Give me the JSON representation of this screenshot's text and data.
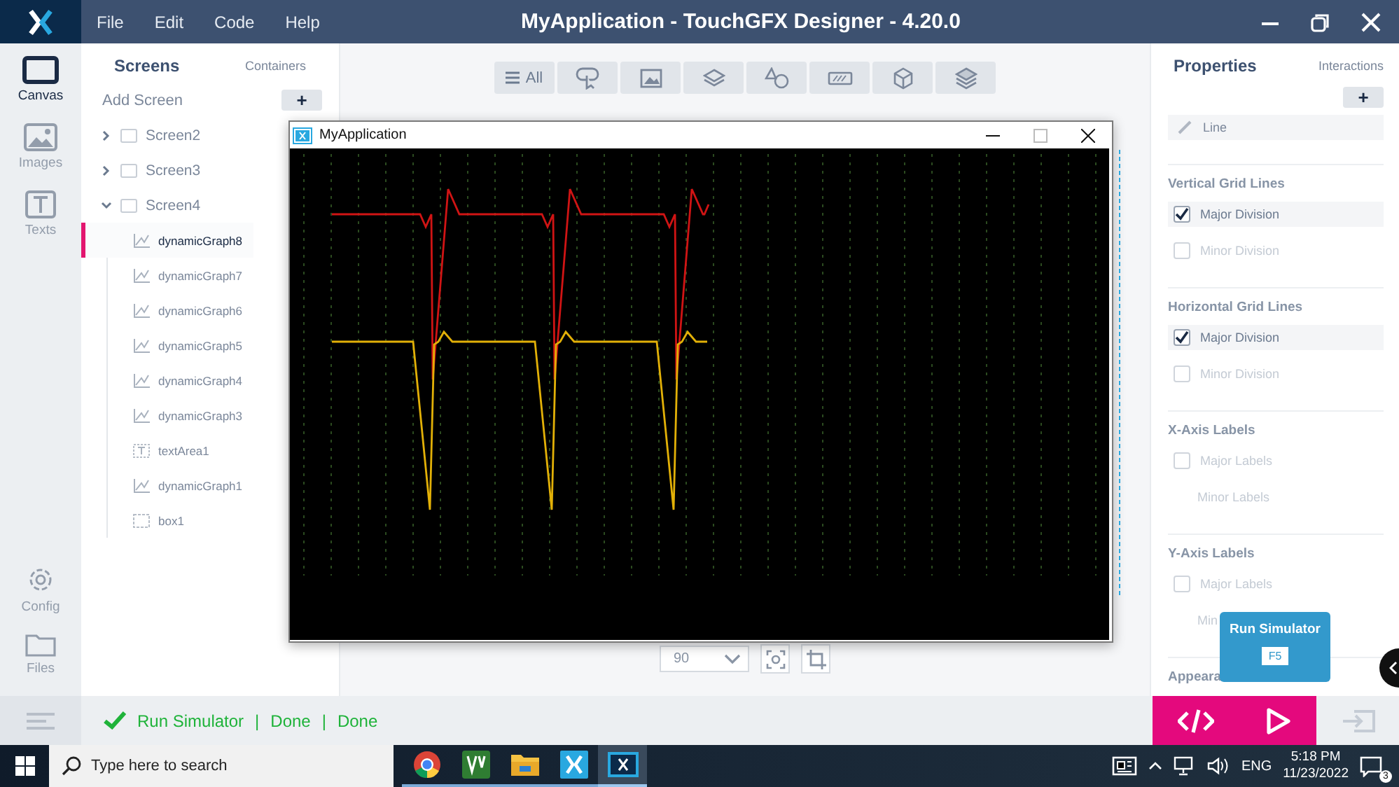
{
  "titlebar": {
    "menu": [
      "File",
      "Edit",
      "Code",
      "Help"
    ],
    "title": "MyApplication - TouchGFX Designer - 4.20.0"
  },
  "rail": {
    "items": [
      {
        "label": "Canvas",
        "kind": "canvas",
        "selected": true
      },
      {
        "label": "Images",
        "kind": "images",
        "selected": false
      },
      {
        "label": "Texts",
        "kind": "texts",
        "selected": false
      }
    ],
    "bottom_items": [
      {
        "label": "Config",
        "kind": "gear",
        "selected": false
      },
      {
        "label": "Files",
        "kind": "folder",
        "selected": false
      }
    ]
  },
  "screens_panel": {
    "tabs": [
      {
        "label": "Screens",
        "selected": true
      },
      {
        "label": "Containers",
        "selected": false
      }
    ],
    "add_label": "Add Screen",
    "add_button": "+",
    "tree": [
      {
        "label": "Screen2",
        "expanded": false
      },
      {
        "label": "Screen3",
        "expanded": false
      },
      {
        "label": "Screen4",
        "expanded": true,
        "children": [
          {
            "label": "dynamicGraph8",
            "kind": "graph",
            "selected": true
          },
          {
            "label": "dynamicGraph7",
            "kind": "graph",
            "selected": false
          },
          {
            "label": "dynamicGraph6",
            "kind": "graph",
            "selected": false
          },
          {
            "label": "dynamicGraph5",
            "kind": "graph",
            "selected": false
          },
          {
            "label": "dynamicGraph4",
            "kind": "graph",
            "selected": false
          },
          {
            "label": "dynamicGraph3",
            "kind": "graph",
            "selected": false
          },
          {
            "label": "textArea1",
            "kind": "text",
            "selected": false
          },
          {
            "label": "dynamicGraph1",
            "kind": "graph",
            "selected": false
          },
          {
            "label": "box1",
            "kind": "box",
            "selected": false
          }
        ]
      }
    ]
  },
  "toolbar": {
    "all_label": "All"
  },
  "canvas_controls": {
    "zoom": "90"
  },
  "simulator": {
    "title": "MyApplication"
  },
  "properties": {
    "tabs": [
      {
        "label": "Properties",
        "selected": true
      },
      {
        "label": "Interactions",
        "selected": false
      }
    ],
    "add_button": "+",
    "line_field": "Line",
    "sections": [
      {
        "heading": "Vertical Grid Lines",
        "rows": [
          {
            "label": "Major Division",
            "kind": "checkbox",
            "checked": true
          },
          {
            "label": "Minor Division",
            "kind": "checkbox",
            "checked": false
          }
        ]
      },
      {
        "heading": "Horizontal Grid Lines",
        "rows": [
          {
            "label": "Major Division",
            "kind": "checkbox",
            "checked": true
          },
          {
            "label": "Minor Division",
            "kind": "checkbox",
            "checked": false
          }
        ]
      },
      {
        "heading": "X-Axis Labels",
        "rows": [
          {
            "label": "Major Labels",
            "kind": "checkbox",
            "checked": false
          },
          {
            "label": "Minor Labels",
            "kind": "plain"
          }
        ]
      },
      {
        "heading": "Y-Axis Labels",
        "rows": [
          {
            "label": "Major Labels",
            "kind": "checkbox",
            "checked": false
          },
          {
            "label": "Min",
            "kind": "plain"
          }
        ]
      },
      {
        "heading": "Appeara"
      }
    ]
  },
  "tooltip": {
    "title": "Run Simulator",
    "shortcut": "F5"
  },
  "status_bar": {
    "parts": [
      "Run Simulator",
      "|",
      "Done",
      "|",
      "Done"
    ]
  },
  "taskbar": {
    "search_placeholder": "Type here to search",
    "apps": [
      {
        "kind": "browser",
        "selected": false
      },
      {
        "kind": "editor",
        "selected": false
      },
      {
        "kind": "folder",
        "selected": false
      },
      {
        "kind": "designer",
        "selected": false
      },
      {
        "kind": "simulator",
        "selected": true
      }
    ],
    "language": "ENG",
    "time": "5:18 PM",
    "date": "11/23/2022",
    "notifications": "3"
  }
}
